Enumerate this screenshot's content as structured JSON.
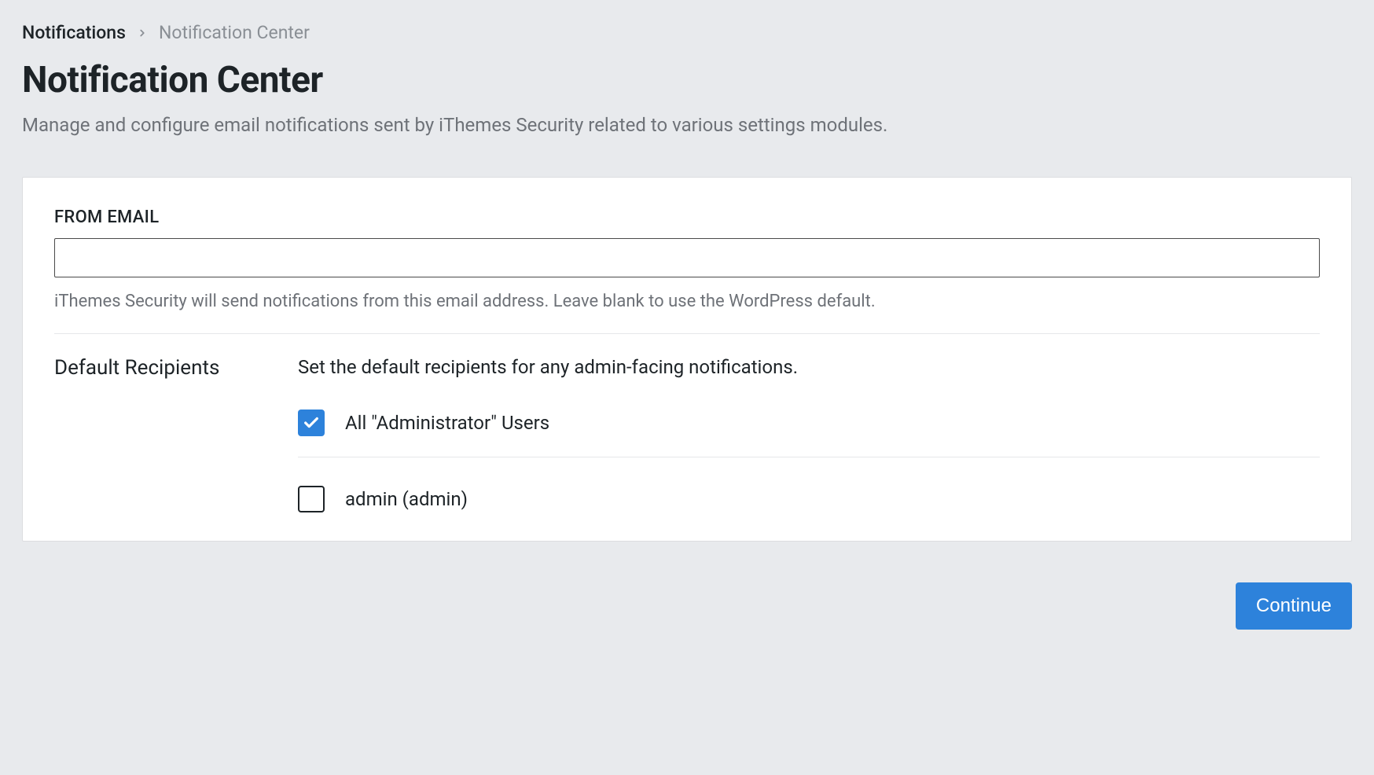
{
  "breadcrumb": {
    "parent": "Notifications",
    "current": "Notification Center"
  },
  "page": {
    "title": "Notification Center",
    "description": "Manage and configure email notifications sent by iThemes Security related to various settings modules."
  },
  "form": {
    "from_email": {
      "label": "FROM EMAIL",
      "value": "",
      "help": "iThemes Security will send notifications from this email address. Leave blank to use the WordPress default."
    },
    "recipients": {
      "title": "Default Recipients",
      "description": "Set the default recipients for any admin-facing notifications.",
      "options": [
        {
          "label": "All \"Administrator\" Users",
          "checked": true
        },
        {
          "label": "admin (admin)",
          "checked": false
        }
      ]
    }
  },
  "actions": {
    "continue": "Continue"
  }
}
